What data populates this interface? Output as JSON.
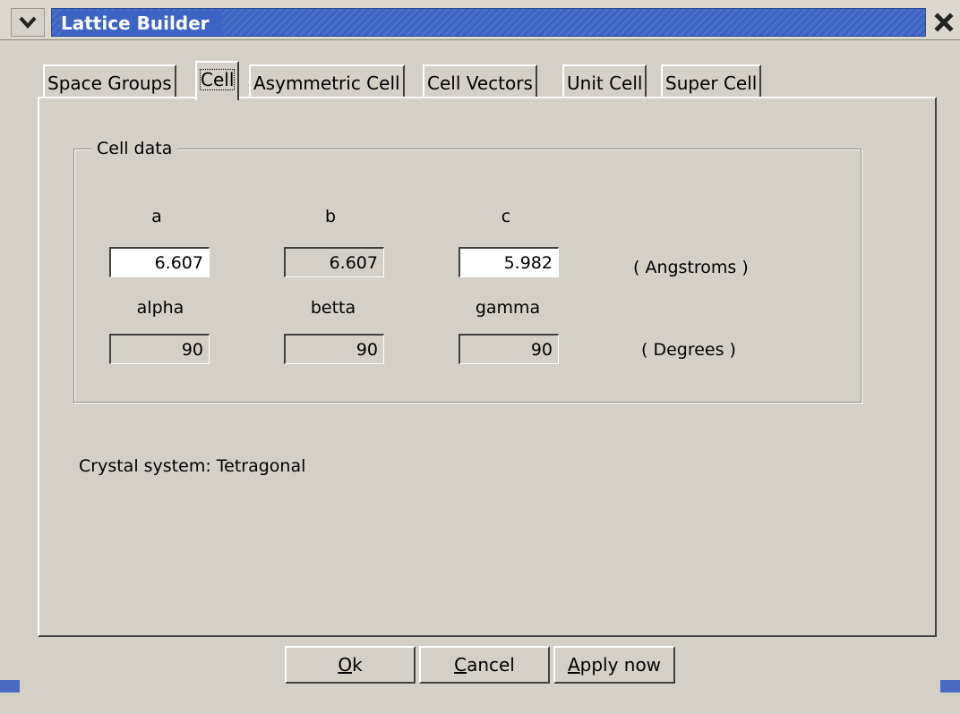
{
  "window": {
    "title": "Lattice Builder",
    "accent": "#3c64c4"
  },
  "tabs": [
    {
      "label": "Space Groups",
      "active": false
    },
    {
      "label": "Cell",
      "active": true
    },
    {
      "label": "Asymmetric Cell",
      "active": false
    },
    {
      "label": "Cell Vectors",
      "active": false
    },
    {
      "label": "Unit Cell",
      "active": false
    },
    {
      "label": "Super Cell",
      "active": false
    }
  ],
  "cell_data": {
    "legend": "Cell data",
    "labels": {
      "a": "a",
      "b": "b",
      "c": "c",
      "alpha": "alpha",
      "betta": "betta",
      "gamma": "gamma"
    },
    "values": {
      "a": "6.607",
      "b": "6.607",
      "c": "5.982",
      "alpha": "90",
      "betta": "90",
      "gamma": "90"
    },
    "length_unit": "( Angstroms )",
    "angle_unit": "( Degrees )"
  },
  "crystal_system": "Crystal system: Tetragonal",
  "buttons": {
    "ok": {
      "mnemonic": "O",
      "rest": "k"
    },
    "cancel": {
      "mnemonic": "C",
      "rest": "ancel"
    },
    "apply": {
      "mnemonic": "A",
      "rest": "pply now"
    }
  },
  "icons": {
    "menu": "chevron-down-icon",
    "close": "close-icon"
  }
}
